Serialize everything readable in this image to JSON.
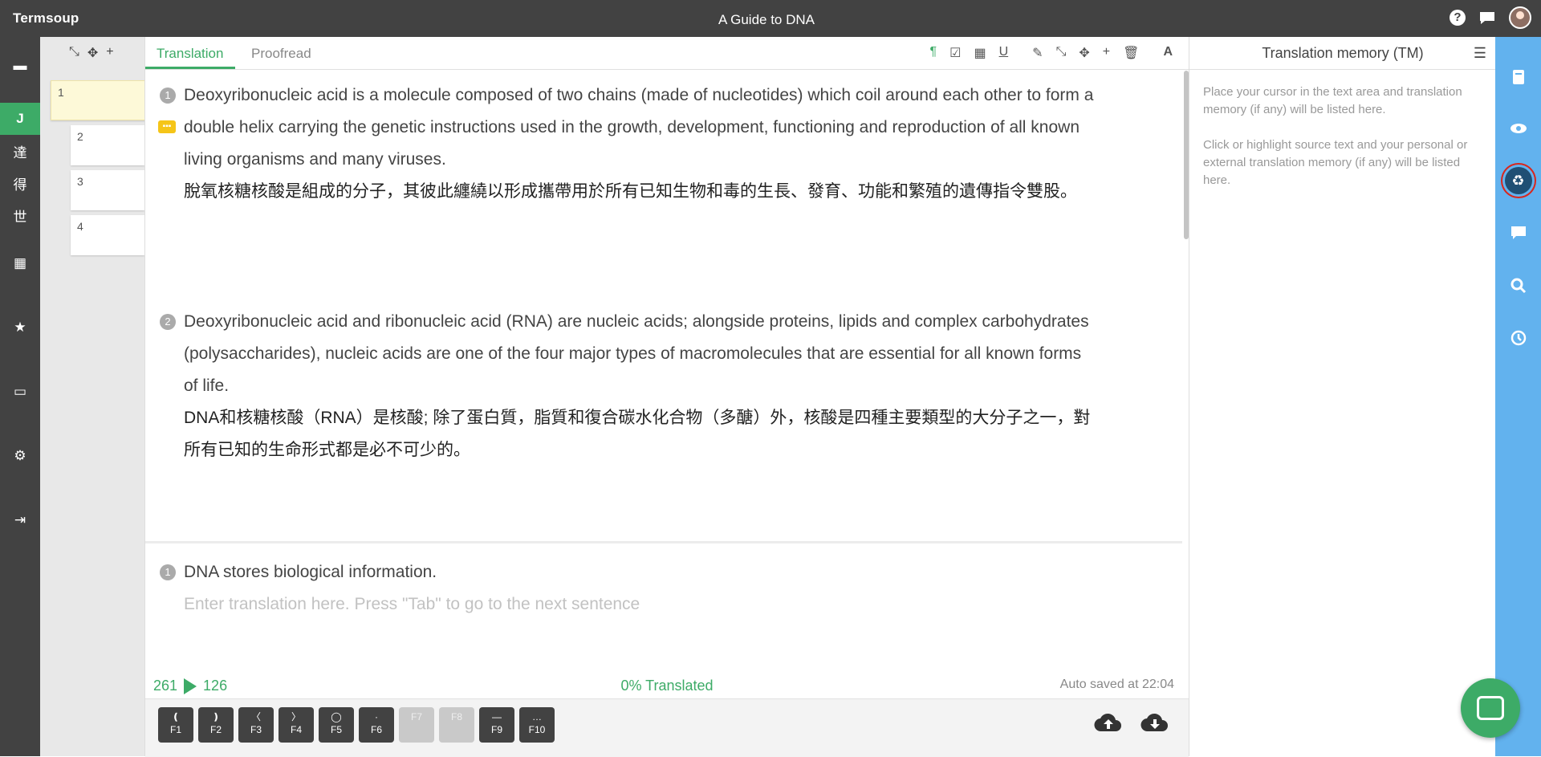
{
  "app": {
    "brand": "Termsoup",
    "doc_title": "A Guide to DNA"
  },
  "top_icons": {
    "help": "?",
    "chat": "chat-icon",
    "avatar": "user-avatar"
  },
  "left_rail": [
    {
      "name": "folder-icon",
      "glyph": "▬"
    },
    {
      "name": "J",
      "glyph": "J",
      "active": true
    },
    {
      "name": "達",
      "glyph": "達"
    },
    {
      "name": "得",
      "glyph": "得"
    },
    {
      "name": "世",
      "glyph": "世"
    },
    {
      "name": "library-icon",
      "glyph": "▦"
    },
    {
      "name": "star-icon",
      "glyph": "★"
    },
    {
      "name": "store-icon",
      "glyph": "▭"
    },
    {
      "name": "gear-icon",
      "glyph": "⚙"
    },
    {
      "name": "logout-icon",
      "glyph": "⇥"
    }
  ],
  "thumbs": {
    "tools": [
      "⤡",
      "✥",
      "+"
    ],
    "pages": [
      "1",
      "2",
      "3",
      "4"
    ]
  },
  "tabs": [
    {
      "label": "Translation"
    },
    {
      "label": "Proofread"
    }
  ],
  "toolbar": [
    "¶",
    "☑",
    "▦",
    "U",
    "✎",
    "⤡",
    "✥",
    "+",
    "🗑",
    "A"
  ],
  "segments": [
    {
      "num": "1",
      "src": "Deoxyribonucleic acid is a molecule composed of two chains (made of nucleotides) which coil around each other to form a double helix carrying the genetic instructions used in the growth, development, functioning and reproduction of all known living organisms and many viruses.",
      "tgt": "脫氧核糖核酸是組成的分子，其彼此纏繞以形成攜帶用於所有已知生物和毒的生長、發育、功能和繁殖的遺傳指令雙股。"
    },
    {
      "num": "2",
      "src": "Deoxyribonucleic acid and ribonucleic acid (RNA) are nucleic acids; alongside proteins, lipids and complex carbohydrates (polysaccharides), nucleic acids are one of the four major types of macromolecules that are essential for all known forms of life.",
      "tgt": "DNA和核糖核酸（RNA）是核酸; 除了蛋白質，脂質和復合碳水化合物（多醣）外，核酸是四種主要類型的大分子之一，對所有已知的生命形式都是必不可少的。"
    }
  ],
  "active_segment": {
    "num": "1",
    "src": "DNA stores biological information.",
    "placeholder": "Enter translation here. Press \"Tab\" to go to the next sentence"
  },
  "status": {
    "left_count": "261",
    "right_count": "126",
    "translated": "0% Translated",
    "autosaved": "Auto saved at 22:04"
  },
  "fkeys": [
    {
      "sym": "❪",
      "label": "F1"
    },
    {
      "sym": "❫",
      "label": "F2"
    },
    {
      "sym": "〈",
      "label": "F3"
    },
    {
      "sym": "〉",
      "label": "F4"
    },
    {
      "sym": "◯",
      "label": "F5"
    },
    {
      "sym": "·",
      "label": "F6"
    },
    {
      "sym": "",
      "label": "F7",
      "dim": true
    },
    {
      "sym": "",
      "label": "F8",
      "dim": true
    },
    {
      "sym": "—",
      "label": "F9"
    },
    {
      "sym": "…",
      "label": "F10"
    }
  ],
  "tm_panel": {
    "title": "Translation memory (TM)",
    "p1": "Place your cursor in the text area and translation memory (if any) will be listed here.",
    "p2": "Click or highlight source text and your personal or external translation memory (if any) will be listed here."
  },
  "right_rail": [
    "notebook-icon",
    "eye-icon",
    "recycle-icon",
    "comment-icon",
    "search-icon",
    "history-icon"
  ],
  "colors": {
    "accent": "#3dab67",
    "dark": "#424242",
    "blue": "#62b2ee",
    "tm_active": "#1f4f74"
  }
}
